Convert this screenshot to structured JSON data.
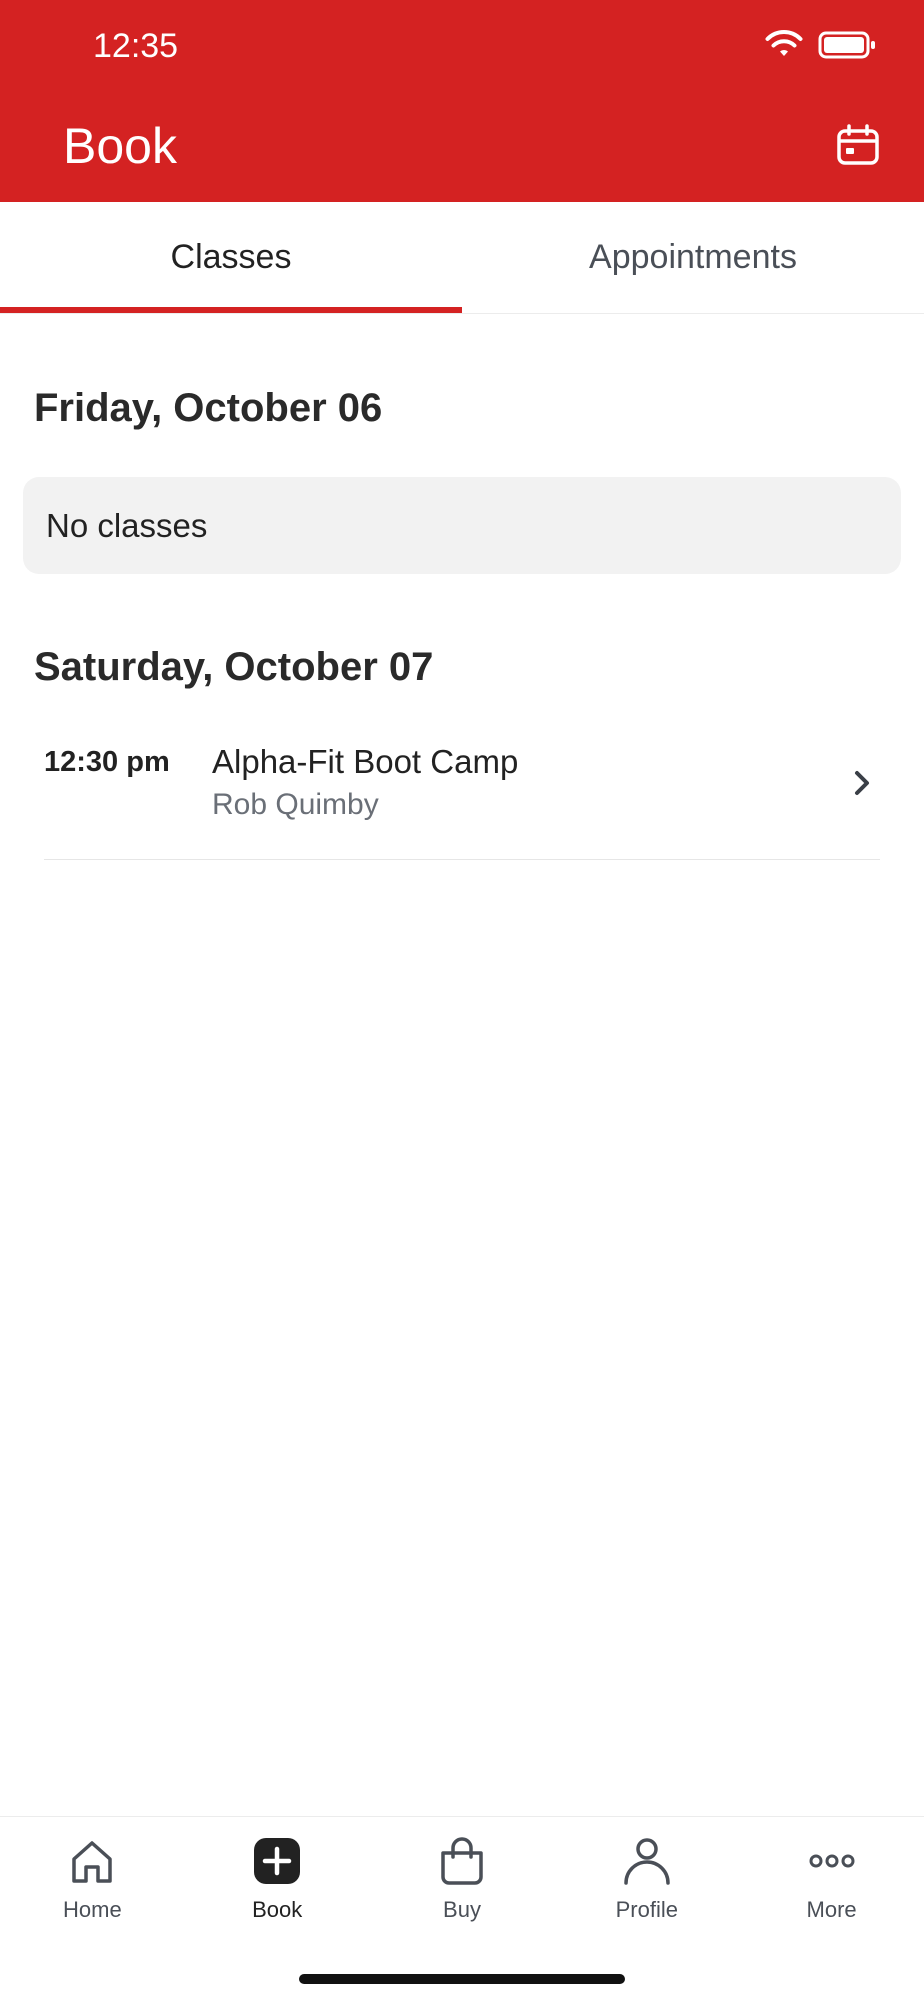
{
  "status_bar": {
    "time": "12:35"
  },
  "header": {
    "title": "Book",
    "calendar_icon": "calendar-icon"
  },
  "tabs": [
    {
      "label": "Classes",
      "active": true
    },
    {
      "label": "Appointments",
      "active": false
    }
  ],
  "days": [
    {
      "heading": "Friday, October 06",
      "empty_text": "No classes"
    },
    {
      "heading": "Saturday, October 07",
      "classes": [
        {
          "time": "12:30 pm",
          "name": "Alpha-Fit Boot Camp",
          "instructor": "Rob Quimby"
        }
      ]
    }
  ],
  "bottom_nav": [
    {
      "label": "Home",
      "icon": "home-icon",
      "active": false
    },
    {
      "label": "Book",
      "icon": "plus-square-icon",
      "active": true
    },
    {
      "label": "Buy",
      "icon": "shopping-bag-icon",
      "active": false
    },
    {
      "label": "Profile",
      "icon": "person-icon",
      "active": false
    },
    {
      "label": "More",
      "icon": "ellipsis-icon",
      "active": false
    }
  ],
  "colors": {
    "accent": "#d42222",
    "active_nav_icon": "#222222",
    "inactive_nav": "#4a4f57"
  }
}
